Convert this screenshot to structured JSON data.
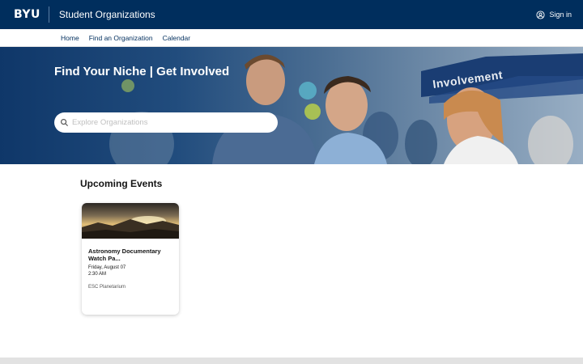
{
  "header": {
    "logo_text": "BYU",
    "site_title": "Student Organizations",
    "signin_label": "Sign in"
  },
  "nav": {
    "items": [
      {
        "label": "Home"
      },
      {
        "label": "Find an Organization"
      },
      {
        "label": "Calendar"
      }
    ]
  },
  "hero": {
    "title": "Find Your Niche | Get Involved",
    "search_placeholder": "Explore Organizations",
    "search_value": "",
    "tent_text": "Involvement"
  },
  "events": {
    "section_title": "Upcoming Events",
    "items": [
      {
        "name": "Astronomy Documentary Watch Pa...",
        "date": "Friday, August 07",
        "time": "2:30 AM",
        "location": "ESC Planetarium"
      }
    ]
  },
  "colors": {
    "brand_navy": "#002e5d",
    "white": "#ffffff"
  },
  "icons": {
    "user": "user-circle-icon",
    "search": "search-icon"
  }
}
